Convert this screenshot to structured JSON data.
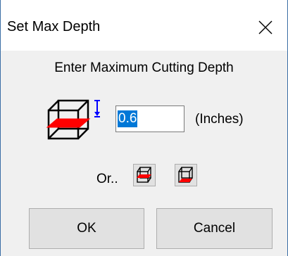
{
  "dialog": {
    "title": "Set Max Depth",
    "close_symbol": "✕"
  },
  "prompt": "Enter Maximum Cutting Depth",
  "depth": {
    "value": "0.6",
    "units": "(Inches)",
    "icon": "box-depth-arrow-icon"
  },
  "alternatives": {
    "label": "Or..",
    "buttons": [
      {
        "name": "mid-plane-cube-icon"
      },
      {
        "name": "bottom-plane-cube-icon"
      }
    ]
  },
  "actions": {
    "ok_label": "OK",
    "cancel_label": "Cancel"
  },
  "colors": {
    "accent_red": "#ff0000",
    "depth_arrow_blue": "#0000ff",
    "selection_blue": "#0078d7"
  }
}
